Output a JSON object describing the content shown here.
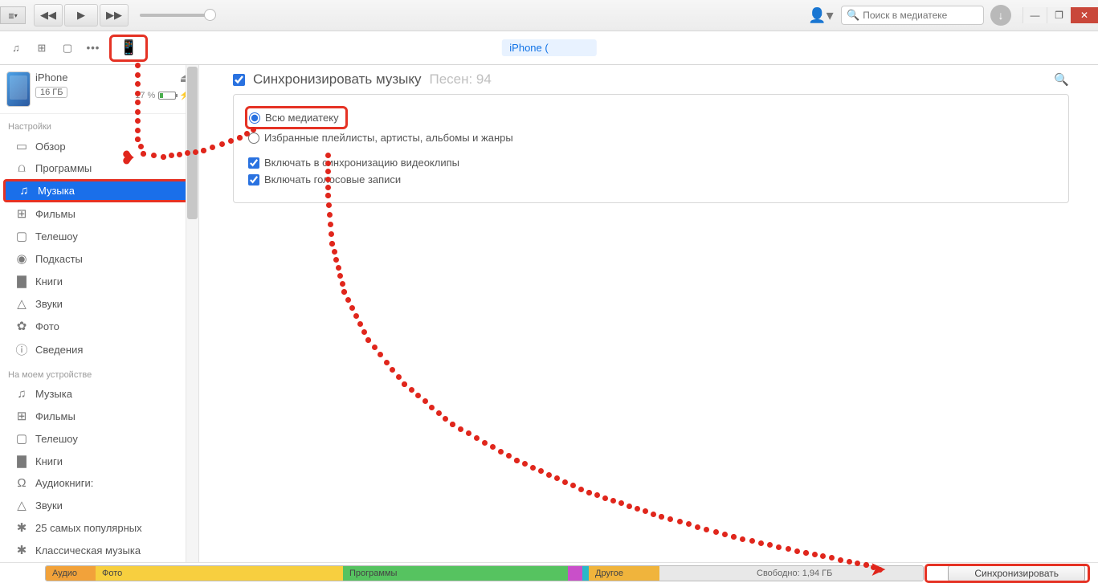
{
  "titlebar": {
    "search_placeholder": "Поиск в медиатеке"
  },
  "sectoolbar": {
    "crumb_label": "iPhone ("
  },
  "device": {
    "name": "iPhone",
    "capacity": "16 ГБ",
    "battery_pct": "17 %"
  },
  "sidebar": {
    "section_settings": "Настройки",
    "section_on_device": "На моем устройстве",
    "settings_items": [
      {
        "icon": "▭",
        "label": "Обзор"
      },
      {
        "icon": "⩍",
        "label": "Программы"
      },
      {
        "icon": "♫",
        "label": "Музыка",
        "selected": true
      },
      {
        "icon": "⊞",
        "label": "Фильмы"
      },
      {
        "icon": "▢",
        "label": "Телешоу"
      },
      {
        "icon": "◉",
        "label": "Подкасты"
      },
      {
        "icon": "▇",
        "label": "Книги"
      },
      {
        "icon": "△",
        "label": "Звуки"
      },
      {
        "icon": "✿",
        "label": "Фото"
      },
      {
        "icon": "ⓘ",
        "label": "Сведения"
      }
    ],
    "device_items": [
      {
        "icon": "♫",
        "label": "Музыка"
      },
      {
        "icon": "⊞",
        "label": "Фильмы"
      },
      {
        "icon": "▢",
        "label": "Телешоу"
      },
      {
        "icon": "▇",
        "label": "Книги"
      },
      {
        "icon": "Ω",
        "label": "Аудиокниги:"
      },
      {
        "icon": "△",
        "label": "Звуки"
      },
      {
        "icon": "✱",
        "label": "25 самых популярных"
      },
      {
        "icon": "✱",
        "label": "Классическая музыка"
      }
    ]
  },
  "content": {
    "sync_music": "Синхронизировать музыку",
    "songs_label": "Песен: 94",
    "opt_entire": "Всю медиатеку",
    "opt_selected": "Избранные плейлисты, артисты, альбомы и жанры",
    "chk_videos": "Включать в синхронизацию видеоклипы",
    "chk_voice": "Включать голосовые записи"
  },
  "bottom": {
    "seg_audio": "Аудио",
    "seg_photo": "Фото",
    "seg_apps": "Программы",
    "seg_docs": "",
    "seg_books": "",
    "seg_other": "Другое",
    "seg_free": "Свободно: 1,94 ГБ",
    "sync_button": "Синхронизировать"
  }
}
